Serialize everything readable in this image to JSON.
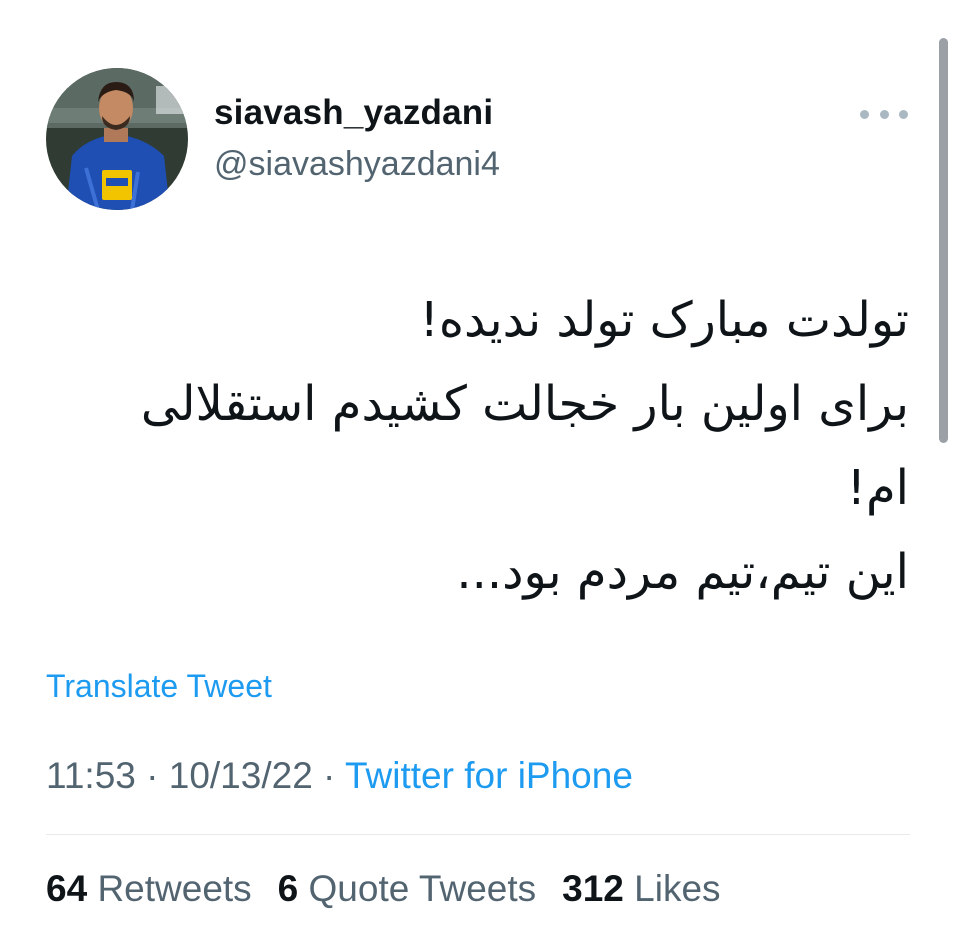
{
  "tweet": {
    "author": {
      "display_name": "siavash_yazdani",
      "handle": "@siavashyazdani4",
      "avatar_icon": "profile-photo-avatar"
    },
    "more_icon": "more-horizontal-icon",
    "body_lines": [
      "تولدت مبارک تولد ندیده!",
      "برای اولین بار خجالت کشیدم استقلالی",
      "ام!",
      "این تیم،تیم مردم بود..."
    ],
    "translate_label": "Translate Tweet",
    "time": "11:53",
    "separator": " · ",
    "date": "10/13/22",
    "source": "Twitter for iPhone",
    "stats": {
      "retweets_count": "64",
      "retweets_label": "Retweets",
      "quote_count": "6",
      "quote_label": "Quote Tweets",
      "likes_count": "312",
      "likes_label": "Likes"
    }
  },
  "colors": {
    "link": "#1d9bf0",
    "secondary_text": "#536471",
    "primary_text": "#0f1419",
    "divider": "#e7e9ea"
  }
}
